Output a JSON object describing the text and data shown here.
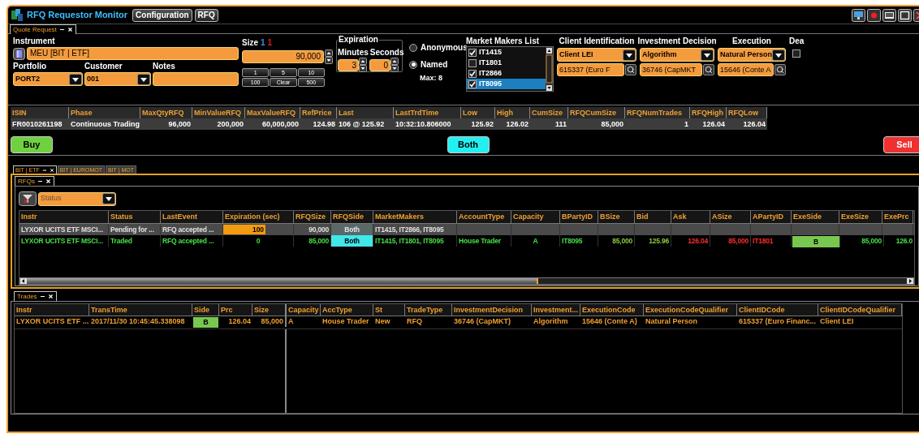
{
  "window": {
    "title": "RFQ Requestor Monitor",
    "buttons": [
      "Configuration",
      "RFQ"
    ]
  },
  "quote_request": {
    "tab": "Quote Request",
    "instrument": {
      "label": "Instrument",
      "value": "MEU [BIT | ETF]"
    },
    "portfolio": {
      "label": "Portfolio",
      "value": "PORT2"
    },
    "customer": {
      "label": "Customer",
      "value": "001"
    },
    "notes": {
      "label": "Notes"
    },
    "size": {
      "label": "Size",
      "marks": [
        {
          "text": "1",
          "color": "#3a8ee6"
        },
        {
          "text": "1",
          "color": "#e02020"
        }
      ],
      "value": "90,000",
      "presets": [
        "1",
        "5",
        "10",
        "100",
        "Clear",
        "500"
      ]
    },
    "expiration": {
      "title": "Expiration",
      "minutes_label": "Minutes",
      "minutes": "3",
      "seconds_label": "Seconds",
      "seconds": "0"
    },
    "visibility": [
      {
        "label": "Anonymous",
        "selected": false
      },
      {
        "label": "Named",
        "selected": true
      }
    ],
    "max": "Max: 8",
    "market_makers": {
      "title": "Market Makers List",
      "items": [
        {
          "label": "IT1415",
          "checked": true,
          "selected": false
        },
        {
          "label": "IT1801",
          "checked": false,
          "selected": false
        },
        {
          "label": "IT2866",
          "checked": true,
          "selected": false
        },
        {
          "label": "IT8095",
          "checked": true,
          "selected": true
        }
      ]
    },
    "client_identification": {
      "label": "Client Identification",
      "choice": "Client LEI",
      "value": "615337 (Euro F"
    },
    "investment_decision": {
      "label": "Investment Decision",
      "choice": "Algorithm",
      "value": "36746 (CapMKT"
    },
    "execution": {
      "label": "Execution",
      "choice": "Natural Person",
      "value": "15646 (Conte A"
    },
    "dea": {
      "label": "Dea",
      "checked": false
    }
  },
  "instrument_info": {
    "columns": [
      "ISIN",
      "Phase",
      "MaxQtyRFQ",
      "MinValueRFQ",
      "MaxValueRFQ",
      "RefPrice",
      "Last",
      "LastTrdTime",
      "Low",
      "High",
      "CumSize",
      "RFQCumSize",
      "RFQNumTrades",
      "RFQHigh",
      "RFQLow"
    ],
    "row": [
      "FR0010261198",
      "Continuous Trading",
      "96,000",
      "200,000",
      "60,000,000",
      "124.98",
      "106 @ 125.92",
      "10:32:10.806000",
      "125.92",
      "126.02",
      "111",
      "85,000",
      "1",
      "126.04",
      "126.04"
    ]
  },
  "sides": [
    {
      "label": "Buy",
      "kind": "buy"
    },
    {
      "label": "Both",
      "kind": "both"
    },
    {
      "label": "Sell",
      "kind": "sell"
    }
  ],
  "market_tabs": [
    {
      "label": "BIT | ETF",
      "selected": true
    },
    {
      "label": "BIT | EUROMOT",
      "selected": false
    },
    {
      "label": "BIT | MOT",
      "selected": false
    }
  ],
  "rfqs": {
    "tab": "RFQs",
    "filter_placeholder": "Status",
    "columns": [
      {
        "label": "Instr",
        "kind": "text"
      },
      {
        "label": "Status",
        "kind": "text"
      },
      {
        "label": "LastEvent",
        "kind": "text"
      },
      {
        "label": "Expiration (sec)",
        "kind": "gauge"
      },
      {
        "label": "RFQSize",
        "kind": "num"
      },
      {
        "label": "RFQSide",
        "kind": "side"
      },
      {
        "label": "MarketMakers",
        "kind": "text"
      },
      {
        "label": "AccountType",
        "kind": "text"
      },
      {
        "label": "Capacity",
        "kind": "center"
      },
      {
        "label": "BPartyID",
        "kind": "text"
      },
      {
        "label": "BSize",
        "kind": "bid"
      },
      {
        "label": "Bid",
        "kind": "bid"
      },
      {
        "label": "Ask",
        "kind": "ask"
      },
      {
        "label": "ASize",
        "kind": "ask"
      },
      {
        "label": "APartyID",
        "kind": "ask_text"
      },
      {
        "label": "ExeSide",
        "kind": "exe_side"
      },
      {
        "label": "ExeSize",
        "kind": "num"
      },
      {
        "label": "ExePrc",
        "kind": "num"
      }
    ],
    "rows": [
      {
        "kind": "pending",
        "level": 0.6,
        "cells": [
          "LYXOR UCITS ETF MSCI...",
          "Pending for ...",
          "RFQ accepted ...",
          "100",
          "90,000",
          "Both",
          "IT1415, IT2866, IT8095"
        ]
      },
      {
        "kind": "traded",
        "cells": [
          "LYXOR UCITS ETF MSCI...",
          "Traded",
          "RFQ accepted ...",
          "0",
          "85,000",
          "Both",
          "IT1415, IT1801, IT8095",
          "House Trader",
          "A",
          "IT8095",
          "85,000",
          "125.96",
          "126.04",
          "85,000",
          "IT1801",
          "B",
          "85,000",
          "126.0"
        ]
      }
    ]
  },
  "trades": {
    "tab": "Trades",
    "columns": [
      {
        "label": "Instr",
        "kind": "text"
      },
      {
        "label": "TransTime",
        "kind": "text"
      },
      {
        "label": "Side",
        "kind": "side"
      },
      {
        "label": "Prc",
        "kind": "num"
      },
      {
        "label": "Size",
        "kind": "num"
      },
      {
        "label": "Capacity",
        "kind": "text"
      },
      {
        "label": "AccType",
        "kind": "text"
      },
      {
        "label": "St",
        "kind": "text"
      },
      {
        "label": "TradeType",
        "kind": "text"
      },
      {
        "label": "InvestmentDecision",
        "kind": "text"
      },
      {
        "label": "Investment...",
        "kind": "text"
      },
      {
        "label": "ExecutionCode",
        "kind": "text"
      },
      {
        "label": "ExecutionCodeQualifier",
        "kind": "text"
      },
      {
        "label": "ClientIDCode",
        "kind": "text"
      },
      {
        "label": "ClientIDCodeQualifier",
        "kind": "text"
      }
    ],
    "rows": [
      {
        "cells": [
          "LYXOR UCITS ETF ...",
          "2017/11/30 10:45:45.338098",
          "B",
          "126.04",
          "85,000",
          "A",
          "House Trader",
          "New",
          "RFQ",
          "36746 (CapMKT)",
          "Algorithm",
          "15646 (Conte A)",
          "Natural Person",
          "615337 (Euro Financ...",
          "Client LEI"
        ]
      }
    ]
  }
}
